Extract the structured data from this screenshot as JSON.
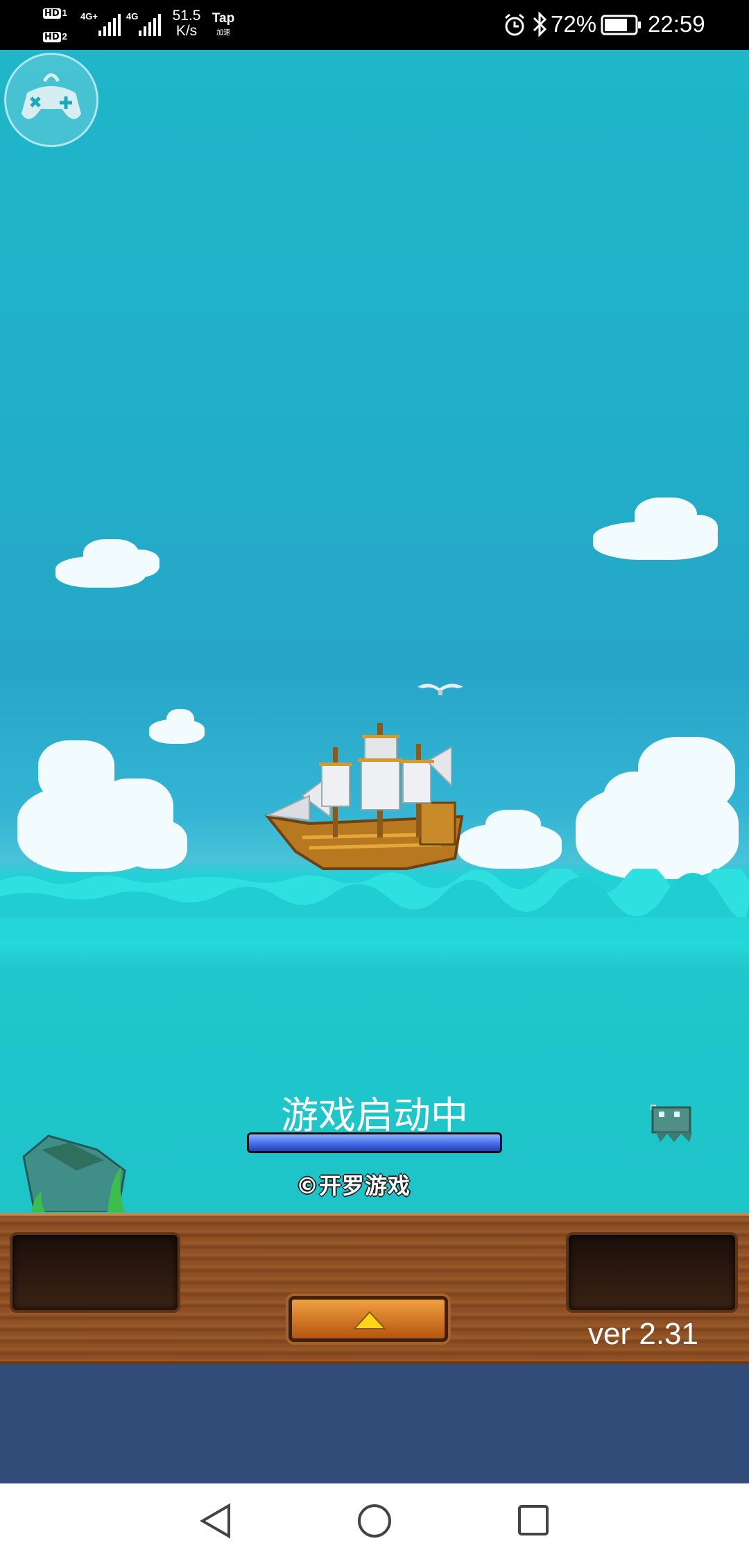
{
  "status_bar": {
    "sim1": "HD",
    "sim1_slot": "1",
    "sim2": "HD",
    "sim2_slot": "2",
    "network1": "4G+",
    "network2": "4G",
    "speed_value": "51.5",
    "speed_unit": "K/s",
    "app_badge": "Tap",
    "app_badge_sub": "加速",
    "battery": "72%",
    "time": "22:59",
    "icons": [
      "alarm-icon",
      "bluetooth-icon",
      "battery-icon",
      "signal-icon"
    ]
  },
  "overlay": {
    "controller_icon": "gamepad-icon"
  },
  "loading": {
    "text": "游戏启动中",
    "progress": 1.0,
    "copyright": "©开罗游戏"
  },
  "panel": {
    "version": "ver 2.31",
    "up_button_icon": "triangle-up-icon"
  },
  "nav": {
    "back_icon": "back-icon",
    "home_icon": "home-icon",
    "recents_icon": "recents-icon"
  },
  "colors": {
    "sky": "#20b0c8",
    "sea": "#1dc4c8",
    "wood": "#8b4d22",
    "navy": "#314c78",
    "loading_bar": "#3f66e6"
  }
}
